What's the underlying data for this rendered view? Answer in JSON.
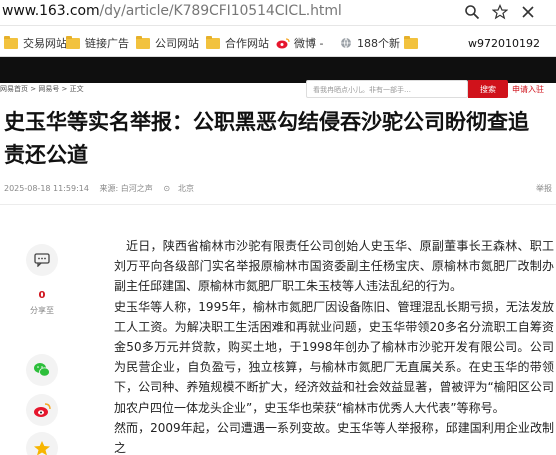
{
  "browser": {
    "url_host": "www.163.com",
    "url_path": "/dy/article/K789CFI10514CICL.html",
    "toolbar_icons": [
      "zoom-icon",
      "star-icon",
      "close-tab-icon"
    ]
  },
  "bookmarks": [
    {
      "label": "交易网站"
    },
    {
      "label": "链接广告"
    },
    {
      "label": "公司网站"
    },
    {
      "label": "合作网站"
    },
    {
      "label": "微博 -"
    },
    {
      "label": "188个新"
    }
  ],
  "user_watermark": "w972010192",
  "site": {
    "breadcrumb": "网易首页 > 网易号 > 正文",
    "search_placeholder": "看我冉晒点小儿。非有一部手…",
    "search_button": "搜索",
    "apply_link": "申请入驻"
  },
  "article": {
    "title": "史玉华等实名举报：公职黑恶勾结侵吞沙驼公司盼彻查追责还公道",
    "date": "2025-08-18 11:59:14",
    "source": "来源: 白河之声",
    "location": "北京",
    "report_label": "举报",
    "comment_count": "0",
    "share_label": "分享至",
    "paragraphs": [
      "近日，陕西省榆林市沙驼有限责任公司创始人史玉华、原副董事长王森林、职工刘万平向各级部门实名举报原榆林市国资委副主任杨宝庆、原榆林市氮肥厂改制办副主任邱建国、原榆林市氮肥厂职工朱玉枝等人违法乱纪的行为。",
      "史玉华等人称，1995年，榆林市氮肥厂因设备陈旧、管理混乱长期亏损，无法发放工人工资。为解决职工生活困难和再就业问题，史玉华带领20多名分流职工自筹资金50多万元并贷款，购买土地，于1998年创办了榆林市沙驼开发有限公司。公司为民营企业，自负盈亏，独立核算，与榆林市氮肥厂无直属关系。在史玉华的带领下，公司种、养殖规模不断扩大，经济效益和社会效益显著，曾被评为“榆阳区公司加农户四位一体龙头企业”，史玉华也荣获“榆林市优秀人大代表”等称号。",
      "然而，2009年起，公司遭遇一系列变故。史玉华等人举报称，邱建国利用企业改制之"
    ]
  }
}
